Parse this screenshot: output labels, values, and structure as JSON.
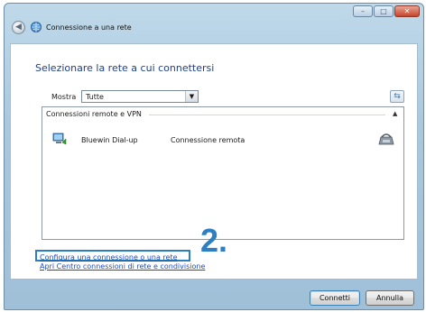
{
  "window": {
    "title": "Connessione a una rete",
    "caption_buttons": {
      "minimize": "–",
      "maximize": "□",
      "close": "✕"
    },
    "back_icon": "◀"
  },
  "content": {
    "heading": "Selezionare la rete a cui connettersi",
    "show_label": "Mostra",
    "filter_value": "Tutte",
    "dropdown_arrow": "▼",
    "refresh_icon": "⇆",
    "group": {
      "label": "Connessioni remote e VPN",
      "collapse_icon": "▲"
    },
    "items": [
      {
        "name": "Bluewin Dial-up",
        "type": "Connessione remota",
        "icon": "dialup-computer-icon",
        "right_icon": "modem-phone-icon"
      }
    ],
    "links": [
      "Configura una connessione o una rete",
      "Apri Centro connessioni di rete e condivisione"
    ],
    "step_label": "2."
  },
  "footer": {
    "connect_label": "Connetti",
    "cancel_label": "Annulla"
  },
  "colors": {
    "accent": "#2d7fc1",
    "heading": "#1e3f8a",
    "link": "#1a4ad1"
  }
}
